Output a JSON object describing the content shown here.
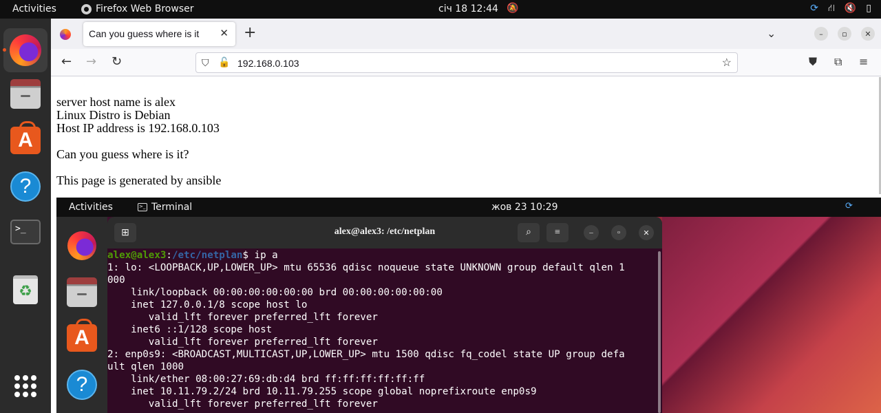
{
  "topbar": {
    "activities": "Activities",
    "app_name": "Firefox Web Browser",
    "clock": "січ 18  12:44"
  },
  "dock": {
    "items": [
      "firefox",
      "files",
      "ubuntu-software",
      "help",
      "terminal",
      "trash",
      "show-apps"
    ]
  },
  "browser": {
    "tab_title": "Can you guess where is it",
    "url": "192.168.0.103",
    "accent": "#e95420"
  },
  "page": {
    "line1": "server host name is alex",
    "line2": "Linux Distro is Debian",
    "line3": "Host IP address is 192.168.0.103",
    "question": "Can you guess where is it?",
    "footer": "This page is generated by ansible"
  },
  "screenshot": {
    "activities": "Activities",
    "app_name": "Terminal",
    "clock": "жов 23  10:29",
    "terminal": {
      "title": "alex@alex3: /etc/netplan",
      "prompt_user": "alex@alex3",
      "prompt_sep": ":",
      "prompt_path": "/etc/netplan",
      "prompt_cmd": "$ ip a",
      "lines": [
        "1: lo: <LOOPBACK,UP,LOWER_UP> mtu 65536 qdisc noqueue state UNKNOWN group default qlen 1",
        "000",
        "    link/loopback 00:00:00:00:00:00 brd 00:00:00:00:00:00",
        "    inet 127.0.0.1/8 scope host lo",
        "       valid_lft forever preferred_lft forever",
        "    inet6 ::1/128 scope host",
        "       valid_lft forever preferred_lft forever",
        "2: enp0s9: <BROADCAST,MULTICAST,UP,LOWER_UP> mtu 1500 qdisc fq_codel state UP group defa",
        "ult qlen 1000",
        "    link/ether 08:00:27:69:db:d4 brd ff:ff:ff:ff:ff:ff",
        "    inet 10.11.79.2/24 brd 10.11.79.255 scope global noprefixroute enp0s9",
        "       valid_lft forever preferred_lft forever"
      ]
    }
  }
}
